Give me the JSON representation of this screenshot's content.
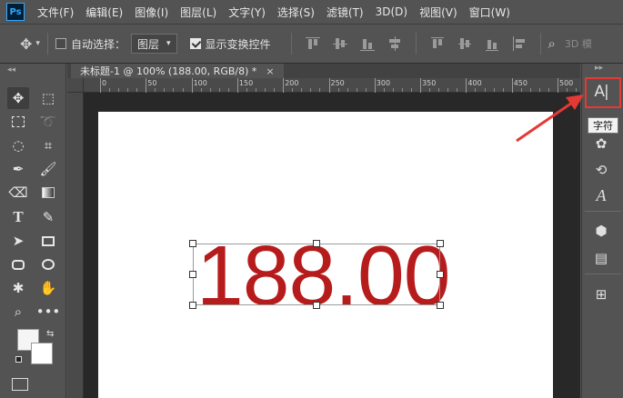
{
  "app": {
    "logo": "Ps"
  },
  "menu": [
    "文件(F)",
    "编辑(E)",
    "图像(I)",
    "图层(L)",
    "文字(Y)",
    "选择(S)",
    "滤镜(T)",
    "3D(D)",
    "视图(V)",
    "窗口(W)"
  ],
  "options_bar": {
    "auto_select_label": "自动选择：",
    "layer_dropdown_value": "图层",
    "show_transform_label": "显示变换控件",
    "mode_3d_label": "3D 模"
  },
  "document": {
    "tab_title": "未标题-1 @ 100% (188.00, RGB/8) *",
    "close_glyph": "×"
  },
  "ruler": {
    "h_labels": [
      "0",
      "50",
      "100",
      "150",
      "200",
      "250",
      "300",
      "350",
      "400",
      "450",
      "500"
    ]
  },
  "canvas": {
    "text": "188.00",
    "text_color": "#b71c1c"
  },
  "right_panel": {
    "character_icon_label": "A|",
    "tooltip": "字符"
  },
  "colors": {
    "annotation_red": "#e53935",
    "canvas_bg": "#ffffff",
    "workspace_bg": "#282828",
    "ui_bg": "#535353"
  }
}
